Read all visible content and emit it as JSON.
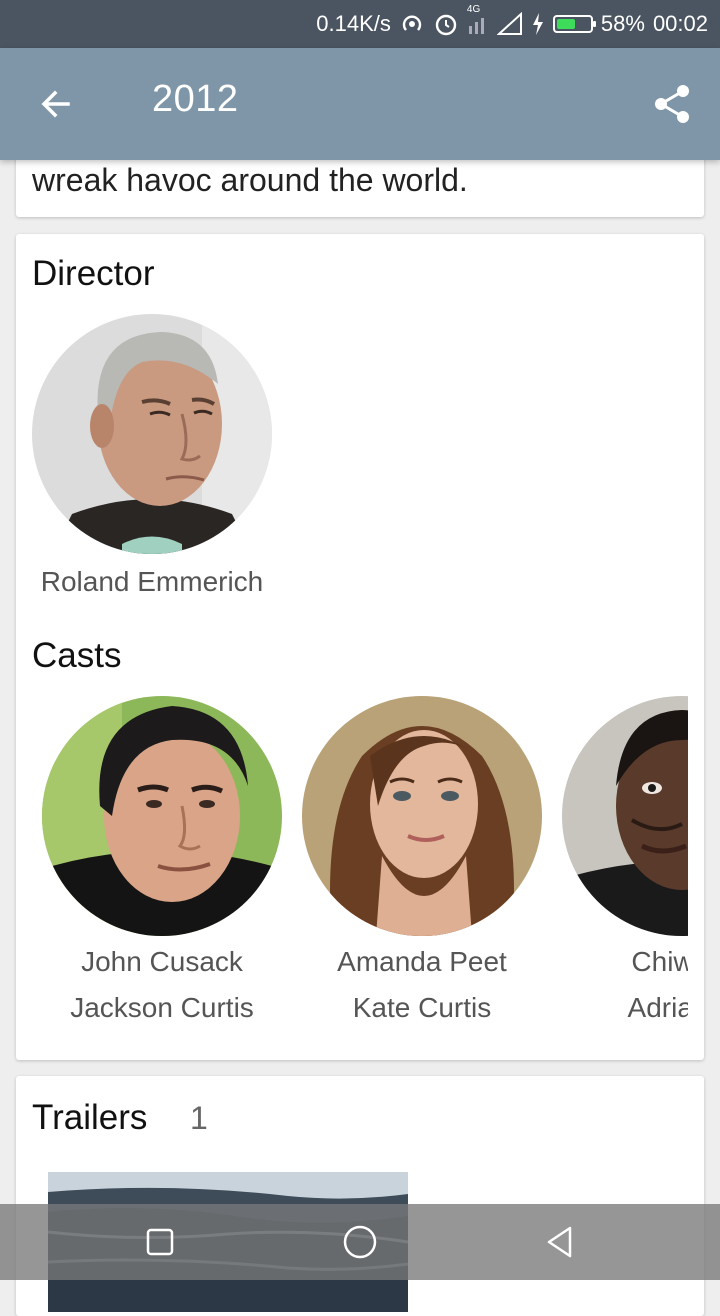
{
  "status_bar": {
    "net_speed": "0.14K/s",
    "network_type": "4G",
    "battery_percent": "58%",
    "battery_level": 0.58,
    "time": "00:02",
    "icons": [
      "hotspot-icon",
      "alarm-icon",
      "signal-icon",
      "charging-icon",
      "battery-icon"
    ]
  },
  "app_bar": {
    "title": "2012",
    "back_icon": "arrow-back-icon",
    "share_icon": "share-icon"
  },
  "overview": {
    "text": "wreak havoc around the world."
  },
  "director_section": {
    "title": "Director",
    "director": {
      "name": "Roland Emmerich"
    }
  },
  "casts_section": {
    "title": "Casts",
    "cast": [
      {
        "actor": "John Cusack",
        "character": "Jackson Curtis"
      },
      {
        "actor": "Amanda Peet",
        "character": "Kate Curtis"
      },
      {
        "actor": "Chiwete",
        "character": "Adrian H"
      }
    ]
  },
  "trailers_section": {
    "title": "Trailers",
    "count": "1"
  },
  "colors": {
    "status_bar": "#4b5561",
    "app_bar": "#7f96a8",
    "background": "#eeeeee",
    "battery_fill": "#3ddc5a"
  },
  "nav_bar": {
    "icons": [
      "recents-square-icon",
      "home-circle-icon",
      "back-triangle-icon"
    ]
  }
}
